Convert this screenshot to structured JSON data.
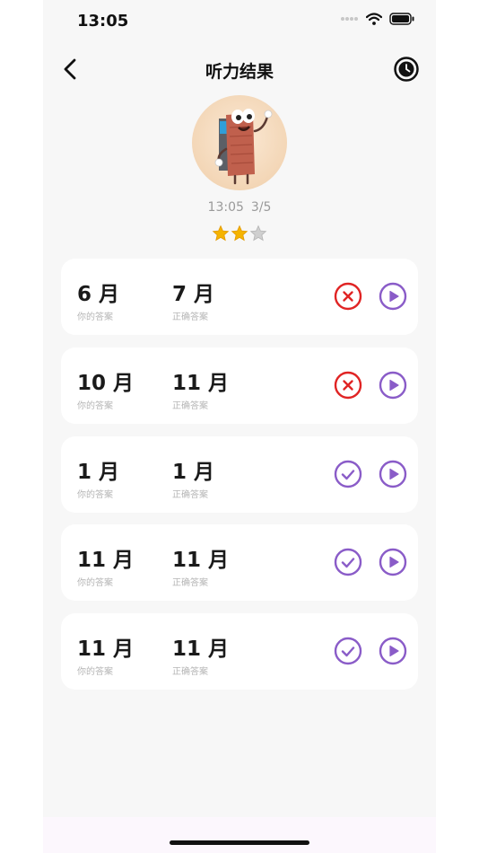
{
  "status_bar": {
    "time": "13:05"
  },
  "header": {
    "title": "听力结果"
  },
  "summary": {
    "time": "13:05",
    "score": "3/5",
    "stars_filled": 2,
    "stars_total": 3
  },
  "labels": {
    "your_answer": "你的答案",
    "correct_answer": "正确答案"
  },
  "results": [
    {
      "user_answer": "6 月",
      "correct_answer": "7 月",
      "correct": false
    },
    {
      "user_answer": "10 月",
      "correct_answer": "11 月",
      "correct": false
    },
    {
      "user_answer": "1 月",
      "correct_answer": "1 月",
      "correct": true
    },
    {
      "user_answer": "11 月",
      "correct_answer": "11 月",
      "correct": true
    },
    {
      "user_answer": "11 月",
      "correct_answer": "11 月",
      "correct": true
    }
  ],
  "colors": {
    "wrong": "#e02424",
    "right": "#8a5cc8",
    "play": "#8a5cc8",
    "star": "#f5b400"
  },
  "icons": {
    "back": "chevron-left-icon",
    "history": "clock-icon",
    "wrong": "x-circle-icon",
    "right": "check-circle-icon",
    "play": "play-circle-icon"
  }
}
